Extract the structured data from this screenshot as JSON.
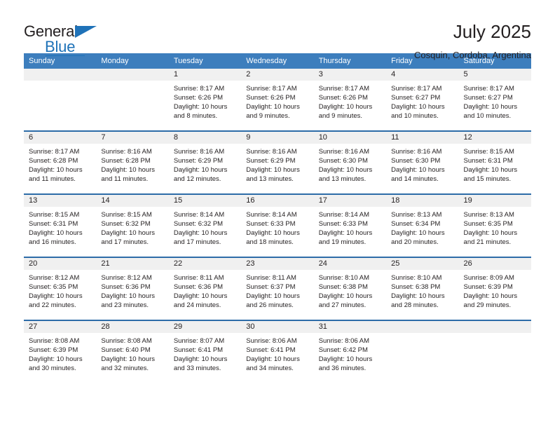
{
  "brand": {
    "name_part1": "General",
    "name_part2": "Blue",
    "accent_color": "#1f72b8"
  },
  "header": {
    "title": "July 2025",
    "subtitle": "Cosquin, Cordoba, Argentina"
  },
  "theme": {
    "header_bg": "#3d7ebd",
    "row_divider": "#2d6ca8",
    "daynum_bg": "#f0f0f0",
    "text": "#231f20"
  },
  "weekdays": [
    "Sunday",
    "Monday",
    "Tuesday",
    "Wednesday",
    "Thursday",
    "Friday",
    "Saturday"
  ],
  "labels": {
    "sunrise": "Sunrise:",
    "sunset": "Sunset:",
    "daylight": "Daylight:"
  },
  "weeks": [
    [
      {
        "day": "",
        "sunrise": "",
        "sunset": "",
        "daylight": ""
      },
      {
        "day": "",
        "sunrise": "",
        "sunset": "",
        "daylight": ""
      },
      {
        "day": "1",
        "sunrise": "Sunrise: 8:17 AM",
        "sunset": "Sunset: 6:26 PM",
        "daylight": "Daylight: 10 hours and 8 minutes."
      },
      {
        "day": "2",
        "sunrise": "Sunrise: 8:17 AM",
        "sunset": "Sunset: 6:26 PM",
        "daylight": "Daylight: 10 hours and 9 minutes."
      },
      {
        "day": "3",
        "sunrise": "Sunrise: 8:17 AM",
        "sunset": "Sunset: 6:26 PM",
        "daylight": "Daylight: 10 hours and 9 minutes."
      },
      {
        "day": "4",
        "sunrise": "Sunrise: 8:17 AM",
        "sunset": "Sunset: 6:27 PM",
        "daylight": "Daylight: 10 hours and 10 minutes."
      },
      {
        "day": "5",
        "sunrise": "Sunrise: 8:17 AM",
        "sunset": "Sunset: 6:27 PM",
        "daylight": "Daylight: 10 hours and 10 minutes."
      }
    ],
    [
      {
        "day": "6",
        "sunrise": "Sunrise: 8:17 AM",
        "sunset": "Sunset: 6:28 PM",
        "daylight": "Daylight: 10 hours and 11 minutes."
      },
      {
        "day": "7",
        "sunrise": "Sunrise: 8:16 AM",
        "sunset": "Sunset: 6:28 PM",
        "daylight": "Daylight: 10 hours and 11 minutes."
      },
      {
        "day": "8",
        "sunrise": "Sunrise: 8:16 AM",
        "sunset": "Sunset: 6:29 PM",
        "daylight": "Daylight: 10 hours and 12 minutes."
      },
      {
        "day": "9",
        "sunrise": "Sunrise: 8:16 AM",
        "sunset": "Sunset: 6:29 PM",
        "daylight": "Daylight: 10 hours and 13 minutes."
      },
      {
        "day": "10",
        "sunrise": "Sunrise: 8:16 AM",
        "sunset": "Sunset: 6:30 PM",
        "daylight": "Daylight: 10 hours and 13 minutes."
      },
      {
        "day": "11",
        "sunrise": "Sunrise: 8:16 AM",
        "sunset": "Sunset: 6:30 PM",
        "daylight": "Daylight: 10 hours and 14 minutes."
      },
      {
        "day": "12",
        "sunrise": "Sunrise: 8:15 AM",
        "sunset": "Sunset: 6:31 PM",
        "daylight": "Daylight: 10 hours and 15 minutes."
      }
    ],
    [
      {
        "day": "13",
        "sunrise": "Sunrise: 8:15 AM",
        "sunset": "Sunset: 6:31 PM",
        "daylight": "Daylight: 10 hours and 16 minutes."
      },
      {
        "day": "14",
        "sunrise": "Sunrise: 8:15 AM",
        "sunset": "Sunset: 6:32 PM",
        "daylight": "Daylight: 10 hours and 17 minutes."
      },
      {
        "day": "15",
        "sunrise": "Sunrise: 8:14 AM",
        "sunset": "Sunset: 6:32 PM",
        "daylight": "Daylight: 10 hours and 17 minutes."
      },
      {
        "day": "16",
        "sunrise": "Sunrise: 8:14 AM",
        "sunset": "Sunset: 6:33 PM",
        "daylight": "Daylight: 10 hours and 18 minutes."
      },
      {
        "day": "17",
        "sunrise": "Sunrise: 8:14 AM",
        "sunset": "Sunset: 6:33 PM",
        "daylight": "Daylight: 10 hours and 19 minutes."
      },
      {
        "day": "18",
        "sunrise": "Sunrise: 8:13 AM",
        "sunset": "Sunset: 6:34 PM",
        "daylight": "Daylight: 10 hours and 20 minutes."
      },
      {
        "day": "19",
        "sunrise": "Sunrise: 8:13 AM",
        "sunset": "Sunset: 6:35 PM",
        "daylight": "Daylight: 10 hours and 21 minutes."
      }
    ],
    [
      {
        "day": "20",
        "sunrise": "Sunrise: 8:12 AM",
        "sunset": "Sunset: 6:35 PM",
        "daylight": "Daylight: 10 hours and 22 minutes."
      },
      {
        "day": "21",
        "sunrise": "Sunrise: 8:12 AM",
        "sunset": "Sunset: 6:36 PM",
        "daylight": "Daylight: 10 hours and 23 minutes."
      },
      {
        "day": "22",
        "sunrise": "Sunrise: 8:11 AM",
        "sunset": "Sunset: 6:36 PM",
        "daylight": "Daylight: 10 hours and 24 minutes."
      },
      {
        "day": "23",
        "sunrise": "Sunrise: 8:11 AM",
        "sunset": "Sunset: 6:37 PM",
        "daylight": "Daylight: 10 hours and 26 minutes."
      },
      {
        "day": "24",
        "sunrise": "Sunrise: 8:10 AM",
        "sunset": "Sunset: 6:38 PM",
        "daylight": "Daylight: 10 hours and 27 minutes."
      },
      {
        "day": "25",
        "sunrise": "Sunrise: 8:10 AM",
        "sunset": "Sunset: 6:38 PM",
        "daylight": "Daylight: 10 hours and 28 minutes."
      },
      {
        "day": "26",
        "sunrise": "Sunrise: 8:09 AM",
        "sunset": "Sunset: 6:39 PM",
        "daylight": "Daylight: 10 hours and 29 minutes."
      }
    ],
    [
      {
        "day": "27",
        "sunrise": "Sunrise: 8:08 AM",
        "sunset": "Sunset: 6:39 PM",
        "daylight": "Daylight: 10 hours and 30 minutes."
      },
      {
        "day": "28",
        "sunrise": "Sunrise: 8:08 AM",
        "sunset": "Sunset: 6:40 PM",
        "daylight": "Daylight: 10 hours and 32 minutes."
      },
      {
        "day": "29",
        "sunrise": "Sunrise: 8:07 AM",
        "sunset": "Sunset: 6:41 PM",
        "daylight": "Daylight: 10 hours and 33 minutes."
      },
      {
        "day": "30",
        "sunrise": "Sunrise: 8:06 AM",
        "sunset": "Sunset: 6:41 PM",
        "daylight": "Daylight: 10 hours and 34 minutes."
      },
      {
        "day": "31",
        "sunrise": "Sunrise: 8:06 AM",
        "sunset": "Sunset: 6:42 PM",
        "daylight": "Daylight: 10 hours and 36 minutes."
      },
      {
        "day": "",
        "sunrise": "",
        "sunset": "",
        "daylight": ""
      },
      {
        "day": "",
        "sunrise": "",
        "sunset": "",
        "daylight": ""
      }
    ]
  ]
}
